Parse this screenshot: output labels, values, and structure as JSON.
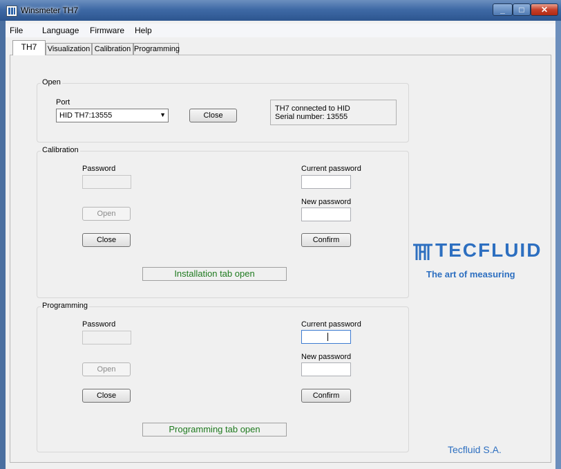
{
  "window": {
    "title": "Winsmeter TH7"
  },
  "menu": [
    "File",
    "Language",
    "Firmware",
    "Help"
  ],
  "tabs": [
    "TH7",
    "Visualization",
    "Calibration",
    "Programming"
  ],
  "open": {
    "group_label": "Open",
    "port_label": "Port",
    "port_value": "HID  TH7:13555",
    "close_button": "Close",
    "status_line1": "TH7 connected to HID",
    "status_line2": "Serial number: 13555"
  },
  "calibration": {
    "group_label": "Calibration",
    "password_label": "Password",
    "open_button": "Open",
    "close_button": "Close",
    "current_password_label": "Current password",
    "new_password_label": "New password",
    "confirm_button": "Confirm",
    "status": "Installation tab open"
  },
  "programming": {
    "group_label": "Programming",
    "password_label": "Password",
    "open_button": "Open",
    "close_button": "Close",
    "current_password_label": "Current password",
    "new_password_label": "New password",
    "confirm_button": "Confirm",
    "status": "Programming tab open"
  },
  "branding": {
    "logo_text": "TECFLUID",
    "tagline": "The art of measuring",
    "company": "Tecfluid S.A.",
    "brand_color": "#2d6fc0"
  },
  "icons": {
    "app": "tecfluid-app-icon",
    "dropdown": "chevron-down-icon"
  }
}
